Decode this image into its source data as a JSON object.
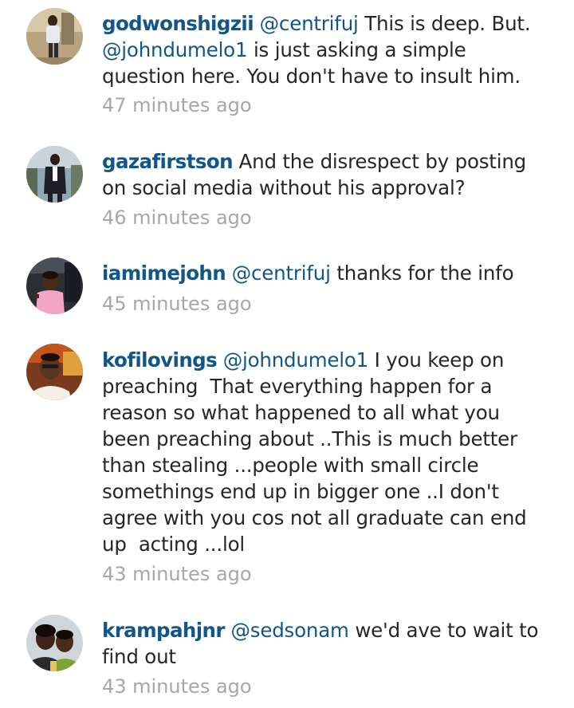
{
  "comments": [
    {
      "username": "godwonshigzii",
      "mention": "@centrifuj",
      "text": " This is deep. But.",
      "mention2": "@johndumelo1",
      "text2": " is just asking a simple question here. You don't have to insult him.",
      "time": "47 minutes ago"
    },
    {
      "username": "gazafirstson",
      "text": " And the disrespect by posting on social media without his approval?",
      "time": "46 minutes ago"
    },
    {
      "username": "iamimejohn",
      "mention": "@centrifuj",
      "text": " thanks for the info",
      "time": "45 minutes ago"
    },
    {
      "username": "kofilovings",
      "mention": "@johndumelo1",
      "text": " I you keep on preaching  That everything happen for a reason so what happened to all what you been preaching about ..This is much better than stealing ...people with small circle somethings end up in bigger one ..I don't agree with you cos not all graduate can end up  acting ...lol",
      "time": "43 minutes ago"
    },
    {
      "username": "krampahjnr",
      "mention": "@sedsonam",
      "text": " we'd ave to wait to find out",
      "time": "43 minutes ago"
    }
  ],
  "colors": {
    "username": "#125688",
    "mention": "#125688",
    "text": "#262626",
    "timestamp": "#a5a7aa"
  }
}
